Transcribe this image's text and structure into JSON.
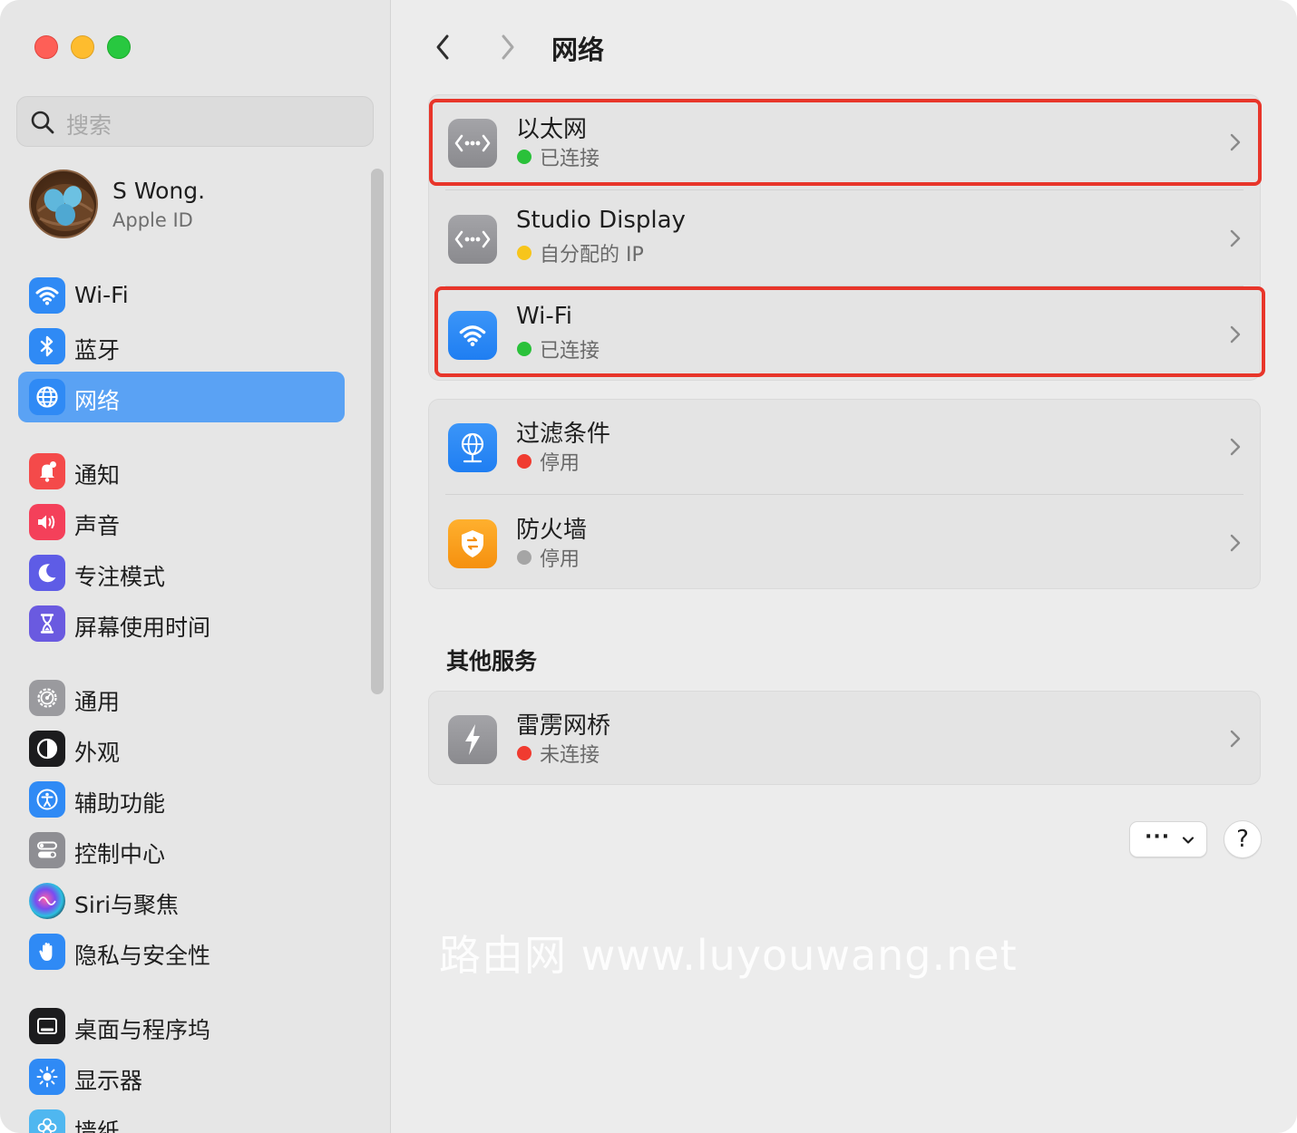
{
  "window": {
    "traffic_lights": {
      "close": "#fe5f57",
      "minimize": "#febc2e",
      "zoom": "#28c840"
    }
  },
  "sidebar": {
    "search": {
      "placeholder": "搜索"
    },
    "profile": {
      "name": "S Wong.",
      "subtitle": "Apple ID"
    },
    "items": [
      {
        "label": "Wi-Fi",
        "icon": "wifi-icon",
        "color": "#2f8af5",
        "active": false
      },
      {
        "label": "蓝牙",
        "icon": "bluetooth-icon",
        "color": "#2f8af5",
        "active": false
      },
      {
        "label": "网络",
        "icon": "globe-icon",
        "color": "#2f8af5",
        "active": true
      },
      {
        "label": "通知",
        "icon": "bell-icon",
        "color": "#f44a4a",
        "active": false
      },
      {
        "label": "声音",
        "icon": "speaker-icon",
        "color": "#f4405a",
        "active": false
      },
      {
        "label": "专注模式",
        "icon": "moon-icon",
        "color": "#5e5ce6",
        "active": false
      },
      {
        "label": "屏幕使用时间",
        "icon": "hourglass-icon",
        "color": "#6a5ae0",
        "active": false
      },
      {
        "label": "通用",
        "icon": "gear-icon",
        "color": "#9a9a9e",
        "active": false
      },
      {
        "label": "外观",
        "icon": "appearance-icon",
        "color": "#1c1c1e",
        "active": false
      },
      {
        "label": "辅助功能",
        "icon": "accessibility-icon",
        "color": "#2f8af5",
        "active": false
      },
      {
        "label": "控制中心",
        "icon": "toggles-icon",
        "color": "#8e8e93",
        "active": false
      },
      {
        "label": "Siri与聚焦",
        "icon": "siri-icon",
        "color": "#3a2a6a",
        "active": false
      },
      {
        "label": "隐私与安全性",
        "icon": "hand-icon",
        "color": "#2f8af5",
        "active": false
      },
      {
        "label": "桌面与程序坞",
        "icon": "dock-icon",
        "color": "#1c1c1e",
        "active": false
      },
      {
        "label": "显示器",
        "icon": "brightness-icon",
        "color": "#2f8af5",
        "active": false
      },
      {
        "label": "墙纸",
        "icon": "flower-icon",
        "color": "#4fb7f0",
        "active": false
      }
    ]
  },
  "header": {
    "title": "网络"
  },
  "network_services": [
    {
      "title": "以太网",
      "status": "已连接",
      "status_color": "#2ac13a",
      "icon": "ethernet-icon",
      "highlighted": true
    },
    {
      "title": "Studio Display",
      "status": "自分配的 IP",
      "status_color": "#f7c51b",
      "icon": "ethernet-icon",
      "highlighted": false
    },
    {
      "title": "Wi-Fi",
      "status": "已连接",
      "status_color": "#2ac13a",
      "icon": "wifi-icon",
      "highlighted": true
    }
  ],
  "security_services": [
    {
      "title": "过滤条件",
      "status": "停用",
      "status_color": "#f03b30",
      "icon": "globe-filter-icon"
    },
    {
      "title": "防火墙",
      "status": "停用",
      "status_color": "#a5a5a5",
      "icon": "firewall-icon"
    }
  ],
  "other_services": {
    "section_title": "其他服务",
    "items": [
      {
        "title": "雷雳网桥",
        "status": "未连接",
        "status_color": "#f03b30",
        "icon": "thunderbolt-icon"
      }
    ]
  },
  "footer": {
    "more_button": "···",
    "help_button": "?"
  },
  "watermark": "路由网 www.luyouwang.net",
  "colors": {
    "highlight": "#e8352a",
    "accent": "#2f8af5",
    "selected_sidebar": "#5aa2f4"
  }
}
